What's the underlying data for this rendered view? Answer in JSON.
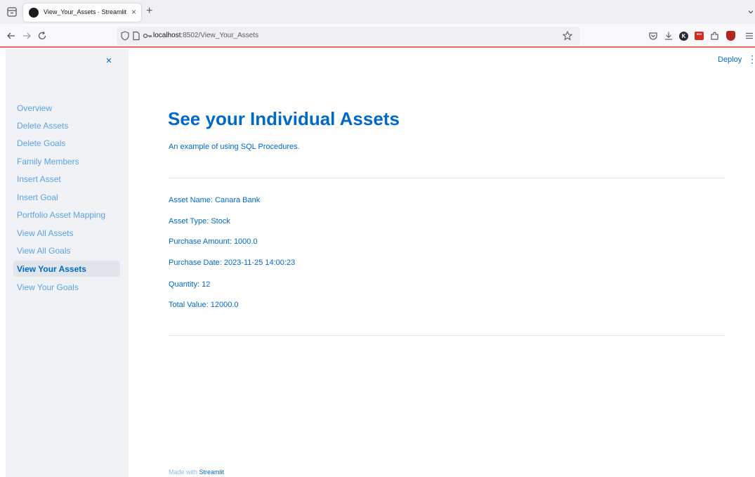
{
  "browser": {
    "tab_title": "View_Your_Assets · Streamlit",
    "url_host": "localhost",
    "url_path": ":8502/View_Your_Assets",
    "new_tab_glyph": "+",
    "tab_close_glyph": "×",
    "icons": {
      "tab_list": "tab-list-icon",
      "back": "back-arrow-icon",
      "forward": "forward-arrow-icon",
      "reload": "reload-icon",
      "shield": "tracking-shield-icon",
      "page": "page-icon",
      "permissions": "key-icon",
      "bookmark": "star-icon",
      "pocket": "pocket-icon",
      "downloads": "download-icon",
      "extensions": "puzzle-icon",
      "overflow": "chevron-down-icon"
    },
    "accent_line_color": "#e86b5b"
  },
  "sidebar": {
    "close_glyph": "×",
    "items": [
      {
        "label": "Overview",
        "active": false
      },
      {
        "label": "Delete Assets",
        "active": false
      },
      {
        "label": "Delete Goals",
        "active": false
      },
      {
        "label": "Family Members",
        "active": false
      },
      {
        "label": "Insert Asset",
        "active": false
      },
      {
        "label": "Insert Goal",
        "active": false
      },
      {
        "label": "Portfolio Asset Mapping",
        "active": false
      },
      {
        "label": "View All Assets",
        "active": false
      },
      {
        "label": "View All Goals",
        "active": false
      },
      {
        "label": "View Your Assets",
        "active": true
      },
      {
        "label": "View Your Goals",
        "active": false
      }
    ]
  },
  "header": {
    "deploy_label": "Deploy",
    "menu_glyph": "⋮"
  },
  "main": {
    "title": "See your Individual Assets",
    "caption": "An example of using SQL Procedures.",
    "fields": [
      "Asset Name: Canara Bank",
      "Asset Type: Stock",
      "Purchase Amount: 1000.0",
      "Purchase Date: 2023-11-25 14:00:23",
      "Quantity: 12",
      "Total Value: 12000.0"
    ]
  },
  "footer": {
    "prefix": "Made with",
    "brand": "Streamlit"
  },
  "colors": {
    "primary": "#0068c9",
    "sidebar_bg": "#f0f2f6",
    "active_item_bg": "#e1e5ec"
  }
}
